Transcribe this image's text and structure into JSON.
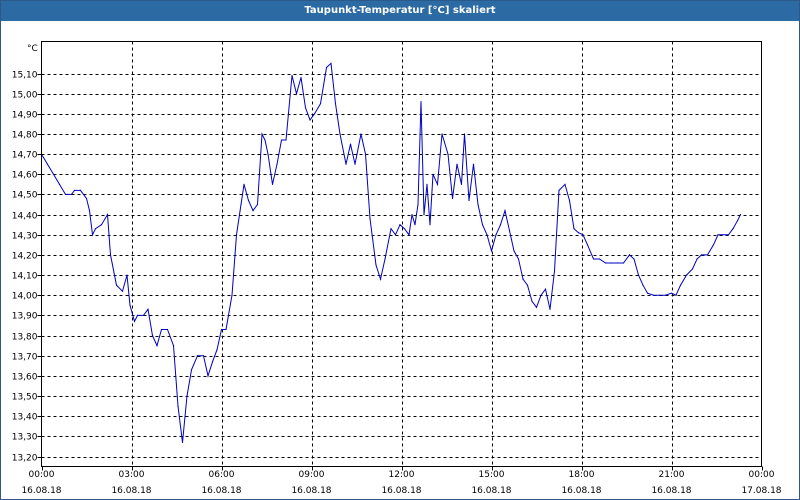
{
  "window": {
    "title": "Taupunkt-Temperatur [°C] skaliert"
  },
  "chart_data": {
    "type": "line",
    "title": "Taupunkt-Temperatur [°C] skaliert",
    "unit_label": "°C",
    "xlabel": "",
    "ylabel": "°C",
    "xlim": [
      0,
      24
    ],
    "ylim": [
      13.2,
      15.2
    ],
    "grid": true,
    "y_ticks": [
      "13,20",
      "13,30",
      "13,40",
      "13,50",
      "13,60",
      "13,70",
      "13,80",
      "13,90",
      "14,00",
      "14,10",
      "14,20",
      "14,30",
      "14,40",
      "14,50",
      "14,60",
      "14,70",
      "14,80",
      "14,90",
      "15,00",
      "15,10"
    ],
    "x_ticks": [
      {
        "time": "00:00",
        "date": "16.08.18"
      },
      {
        "time": "03:00",
        "date": "16.08.18"
      },
      {
        "time": "06:00",
        "date": "16.08.18"
      },
      {
        "time": "09:00",
        "date": "16.08.18"
      },
      {
        "time": "12:00",
        "date": "16.08.18"
      },
      {
        "time": "15:00",
        "date": "16.08.18"
      },
      {
        "time": "18:00",
        "date": "16.08.18"
      },
      {
        "time": "21:00",
        "date": "16.08.18"
      },
      {
        "time": "00:00",
        "date": "17.08.18"
      }
    ],
    "series": [
      {
        "color": "#0000c0",
        "points": [
          [
            0.0,
            14.7
          ],
          [
            0.2,
            14.65
          ],
          [
            0.4,
            14.6
          ],
          [
            0.6,
            14.55
          ],
          [
            0.8,
            14.5
          ],
          [
            1.0,
            14.5
          ],
          [
            1.1,
            14.52
          ],
          [
            1.3,
            14.52
          ],
          [
            1.5,
            14.48
          ],
          [
            1.6,
            14.42
          ],
          [
            1.7,
            14.3
          ],
          [
            1.8,
            14.33
          ],
          [
            2.0,
            14.35
          ],
          [
            2.2,
            14.4
          ],
          [
            2.3,
            14.2
          ],
          [
            2.5,
            14.05
          ],
          [
            2.7,
            14.02
          ],
          [
            2.85,
            14.1
          ],
          [
            2.95,
            13.95
          ],
          [
            3.1,
            13.87
          ],
          [
            3.2,
            13.9
          ],
          [
            3.4,
            13.9
          ],
          [
            3.55,
            13.93
          ],
          [
            3.7,
            13.8
          ],
          [
            3.85,
            13.75
          ],
          [
            4.0,
            13.83
          ],
          [
            4.2,
            13.83
          ],
          [
            4.4,
            13.75
          ],
          [
            4.55,
            13.45
          ],
          [
            4.7,
            13.27
          ],
          [
            4.85,
            13.5
          ],
          [
            5.0,
            13.63
          ],
          [
            5.2,
            13.7
          ],
          [
            5.4,
            13.7
          ],
          [
            5.55,
            13.6
          ],
          [
            5.7,
            13.67
          ],
          [
            5.85,
            13.73
          ],
          [
            6.0,
            13.83
          ],
          [
            6.15,
            13.83
          ],
          [
            6.35,
            14.0
          ],
          [
            6.5,
            14.3
          ],
          [
            6.65,
            14.45
          ],
          [
            6.75,
            14.55
          ],
          [
            6.9,
            14.47
          ],
          [
            7.05,
            14.42
          ],
          [
            7.2,
            14.45
          ],
          [
            7.35,
            14.8
          ],
          [
            7.45,
            14.77
          ],
          [
            7.55,
            14.7
          ],
          [
            7.7,
            14.55
          ],
          [
            7.85,
            14.65
          ],
          [
            8.0,
            14.77
          ],
          [
            8.15,
            14.77
          ],
          [
            8.35,
            15.09
          ],
          [
            8.5,
            15.0
          ],
          [
            8.65,
            15.08
          ],
          [
            8.8,
            14.93
          ],
          [
            8.95,
            14.87
          ],
          [
            9.1,
            14.9
          ],
          [
            9.3,
            14.95
          ],
          [
            9.5,
            15.13
          ],
          [
            9.65,
            15.15
          ],
          [
            9.8,
            14.95
          ],
          [
            9.95,
            14.8
          ],
          [
            10.15,
            14.65
          ],
          [
            10.3,
            14.75
          ],
          [
            10.45,
            14.65
          ],
          [
            10.65,
            14.8
          ],
          [
            10.8,
            14.7
          ],
          [
            10.95,
            14.38
          ],
          [
            11.15,
            14.15
          ],
          [
            11.3,
            14.08
          ],
          [
            11.45,
            14.18
          ],
          [
            11.65,
            14.33
          ],
          [
            11.8,
            14.3
          ],
          [
            11.95,
            14.35
          ],
          [
            12.1,
            14.33
          ],
          [
            12.25,
            14.3
          ],
          [
            12.35,
            14.4
          ],
          [
            12.45,
            14.35
          ],
          [
            12.55,
            14.45
          ],
          [
            12.65,
            14.96
          ],
          [
            12.75,
            14.4
          ],
          [
            12.85,
            14.55
          ],
          [
            12.95,
            14.35
          ],
          [
            13.05,
            14.6
          ],
          [
            13.2,
            14.55
          ],
          [
            13.35,
            14.8
          ],
          [
            13.55,
            14.7
          ],
          [
            13.7,
            14.48
          ],
          [
            13.85,
            14.65
          ],
          [
            14.0,
            14.55
          ],
          [
            14.1,
            14.8
          ],
          [
            14.25,
            14.47
          ],
          [
            14.4,
            14.65
          ],
          [
            14.55,
            14.45
          ],
          [
            14.7,
            14.35
          ],
          [
            14.85,
            14.3
          ],
          [
            15.0,
            14.22
          ],
          [
            15.15,
            14.3
          ],
          [
            15.3,
            14.35
          ],
          [
            15.45,
            14.42
          ],
          [
            15.6,
            14.32
          ],
          [
            15.75,
            14.22
          ],
          [
            15.9,
            14.18
          ],
          [
            16.05,
            14.08
          ],
          [
            16.2,
            14.05
          ],
          [
            16.35,
            13.97
          ],
          [
            16.5,
            13.94
          ],
          [
            16.65,
            14.0
          ],
          [
            16.8,
            14.03
          ],
          [
            16.95,
            13.93
          ],
          [
            17.1,
            14.12
          ],
          [
            17.25,
            14.52
          ],
          [
            17.45,
            14.55
          ],
          [
            17.6,
            14.47
          ],
          [
            17.75,
            14.33
          ],
          [
            17.9,
            14.31
          ],
          [
            18.05,
            14.3
          ],
          [
            18.2,
            14.25
          ],
          [
            18.4,
            14.18
          ],
          [
            18.6,
            14.18
          ],
          [
            18.8,
            14.16
          ],
          [
            19.0,
            14.16
          ],
          [
            19.2,
            14.16
          ],
          [
            19.4,
            14.16
          ],
          [
            19.6,
            14.2
          ],
          [
            19.75,
            14.18
          ],
          [
            19.9,
            14.1
          ],
          [
            20.05,
            14.05
          ],
          [
            20.2,
            14.01
          ],
          [
            20.4,
            14.0
          ],
          [
            20.6,
            14.0
          ],
          [
            20.8,
            14.0
          ],
          [
            21.0,
            14.01
          ],
          [
            21.15,
            14.0
          ],
          [
            21.3,
            14.05
          ],
          [
            21.5,
            14.1
          ],
          [
            21.7,
            14.13
          ],
          [
            21.85,
            14.18
          ],
          [
            22.0,
            14.2
          ],
          [
            22.2,
            14.2
          ],
          [
            22.4,
            14.25
          ],
          [
            22.55,
            14.3
          ],
          [
            22.7,
            14.3
          ],
          [
            22.9,
            14.3
          ],
          [
            23.05,
            14.33
          ],
          [
            23.2,
            14.37
          ],
          [
            23.3,
            14.4
          ]
        ]
      }
    ]
  }
}
